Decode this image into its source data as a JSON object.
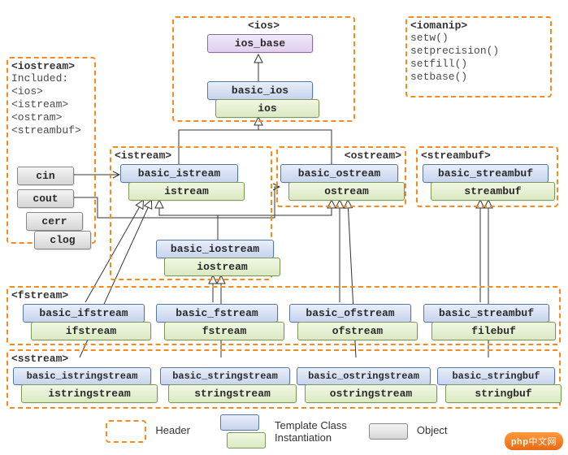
{
  "headers": {
    "ios": {
      "title": "<ios>"
    },
    "iomanip": {
      "title": "<iomanip>",
      "lines": [
        "setw()",
        "setprecision()",
        "setfill()",
        "setbase()"
      ]
    },
    "iostream": {
      "title": "<iostream>",
      "lines": [
        "Included:",
        "<ios>",
        "<istream>",
        "<ostram>",
        "<streambuf>"
      ]
    },
    "istream": {
      "title": "<istream>"
    },
    "ostream": {
      "title": "<ostream>"
    },
    "streambuf": {
      "title": "<streambuf>"
    },
    "fstream": {
      "title": "<fstream>"
    },
    "sstream": {
      "title": "<sstream>"
    }
  },
  "classes": {
    "ios_base": {
      "template": "ios_base"
    },
    "basic_ios": {
      "template": "basic_ios",
      "instance": "ios"
    },
    "basic_istream": {
      "template": "basic_istream",
      "instance": "istream"
    },
    "basic_ostream": {
      "template": "basic_ostream",
      "instance": "ostream"
    },
    "basic_iostream": {
      "template": "basic_iostream",
      "instance": "iostream"
    },
    "basic_streambuf": {
      "template": "basic_streambuf",
      "instance": "streambuf"
    },
    "basic_ifstream": {
      "template": "basic_ifstream",
      "instance": "ifstream"
    },
    "basic_fstream": {
      "template": "basic_fstream",
      "instance": "fstream"
    },
    "basic_ofstream": {
      "template": "basic_ofstream",
      "instance": "ofstream"
    },
    "filebuf": {
      "template": "basic_streambuf",
      "instance": "filebuf"
    },
    "basic_istringstream": {
      "template": "basic_istringstream",
      "instance": "istringstream"
    },
    "basic_stringstream": {
      "template": "basic_stringstream",
      "instance": "stringstream"
    },
    "basic_ostringstream": {
      "template": "basic_ostringstream",
      "instance": "ostringstream"
    },
    "basic_stringbuf": {
      "template": "basic_stringbuf",
      "instance": "stringbuf"
    }
  },
  "objects": {
    "cin": "cin",
    "cout": "cout",
    "cerr": "cerr",
    "clog": "clog"
  },
  "legend": {
    "header": "Header",
    "template_class": "Template Class",
    "instantiation": "Instantiation",
    "object": "Object"
  },
  "watermark": {
    "brand": "php",
    "suffix": "中文网"
  }
}
